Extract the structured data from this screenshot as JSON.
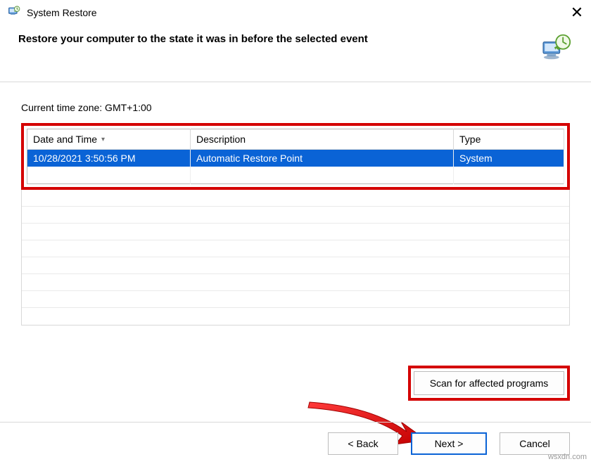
{
  "window": {
    "title": "System Restore"
  },
  "header": {
    "headline": "Restore your computer to the state it was in before the selected event"
  },
  "timezone_label": "Current time zone: GMT+1:00",
  "columns": {
    "datetime": "Date and Time",
    "description": "Description",
    "type": "Type"
  },
  "restore_points": [
    {
      "datetime": "10/28/2021 3:50:56 PM",
      "description": "Automatic Restore Point",
      "type": "System"
    }
  ],
  "buttons": {
    "scan": "Scan for affected programs",
    "back": "< Back",
    "next": "Next >",
    "cancel": "Cancel"
  },
  "watermark": "wsxdn.com"
}
